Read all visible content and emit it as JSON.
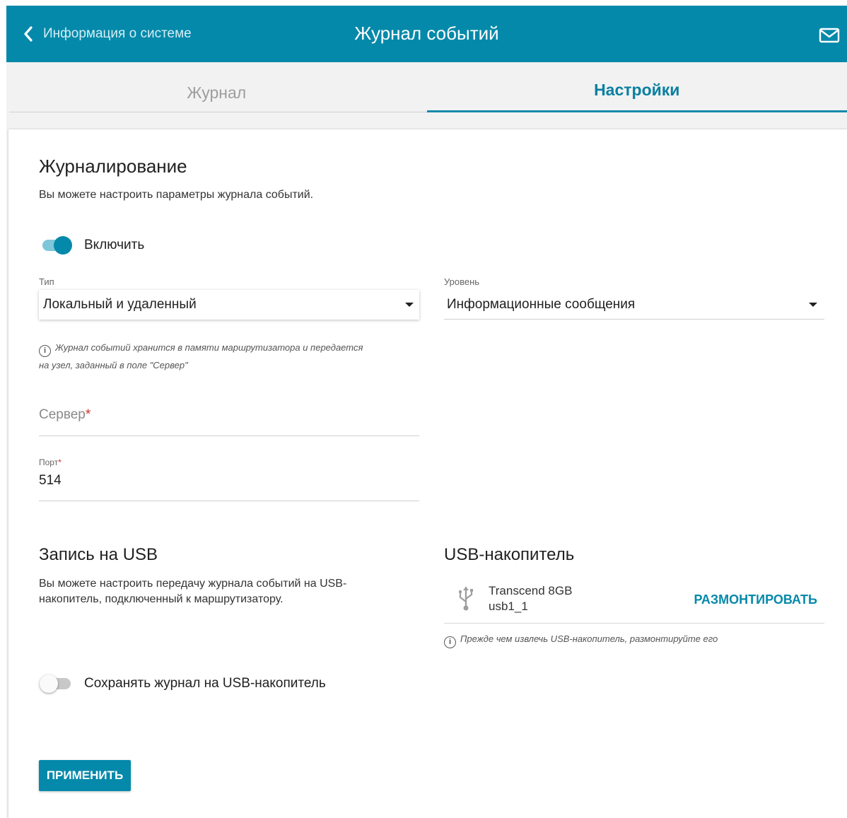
{
  "header": {
    "back_label": "Информация о системе",
    "title": "Журнал событий",
    "back_icon": "chevron-left-icon",
    "mail_icon": "mail-icon"
  },
  "tabs": [
    {
      "label": "Журнал",
      "active": false
    },
    {
      "label": "Настройки",
      "active": true
    }
  ],
  "logging": {
    "title": "Журналирование",
    "description": "Вы можете настроить параметры журнала событий.",
    "enable_label": "Включить",
    "enable_on": true,
    "type": {
      "label": "Тип",
      "value": "Локальный и удаленный"
    },
    "level": {
      "label": "Уровень",
      "value": "Информационные сообщения"
    },
    "hint_line1": "Журнал событий хранится в памяти маршрутизатора и передается",
    "hint_line2": "на узел, заданный в поле \"Сервер\"",
    "server": {
      "placeholder": "Сервер",
      "required_mark": "*",
      "value": ""
    },
    "port": {
      "label": "Порт",
      "required_mark": "*",
      "value": "514"
    }
  },
  "usb_record": {
    "title": "Запись на USB",
    "description_line1": "Вы можете настроить передачу журнала событий на USB-",
    "description_line2": "накопитель, подключенный к маршрутизатору.",
    "save_label": "Сохранять журнал на USB-накопитель",
    "save_on": false
  },
  "usb_drive": {
    "title": "USB-накопитель",
    "device_name": "Transcend 8GB",
    "device_id": "usb1_1",
    "unmount_label": "РАЗМОНТИРОВАТЬ",
    "hint": "Прежде чем извлечь USB-накопитель, размонтируйте его",
    "icon": "usb-icon"
  },
  "apply_label": "ПРИМЕНИТЬ",
  "colors": {
    "accent": "#0489aa",
    "tab_active": "#0a7fa0",
    "required": "#d32f2f"
  }
}
